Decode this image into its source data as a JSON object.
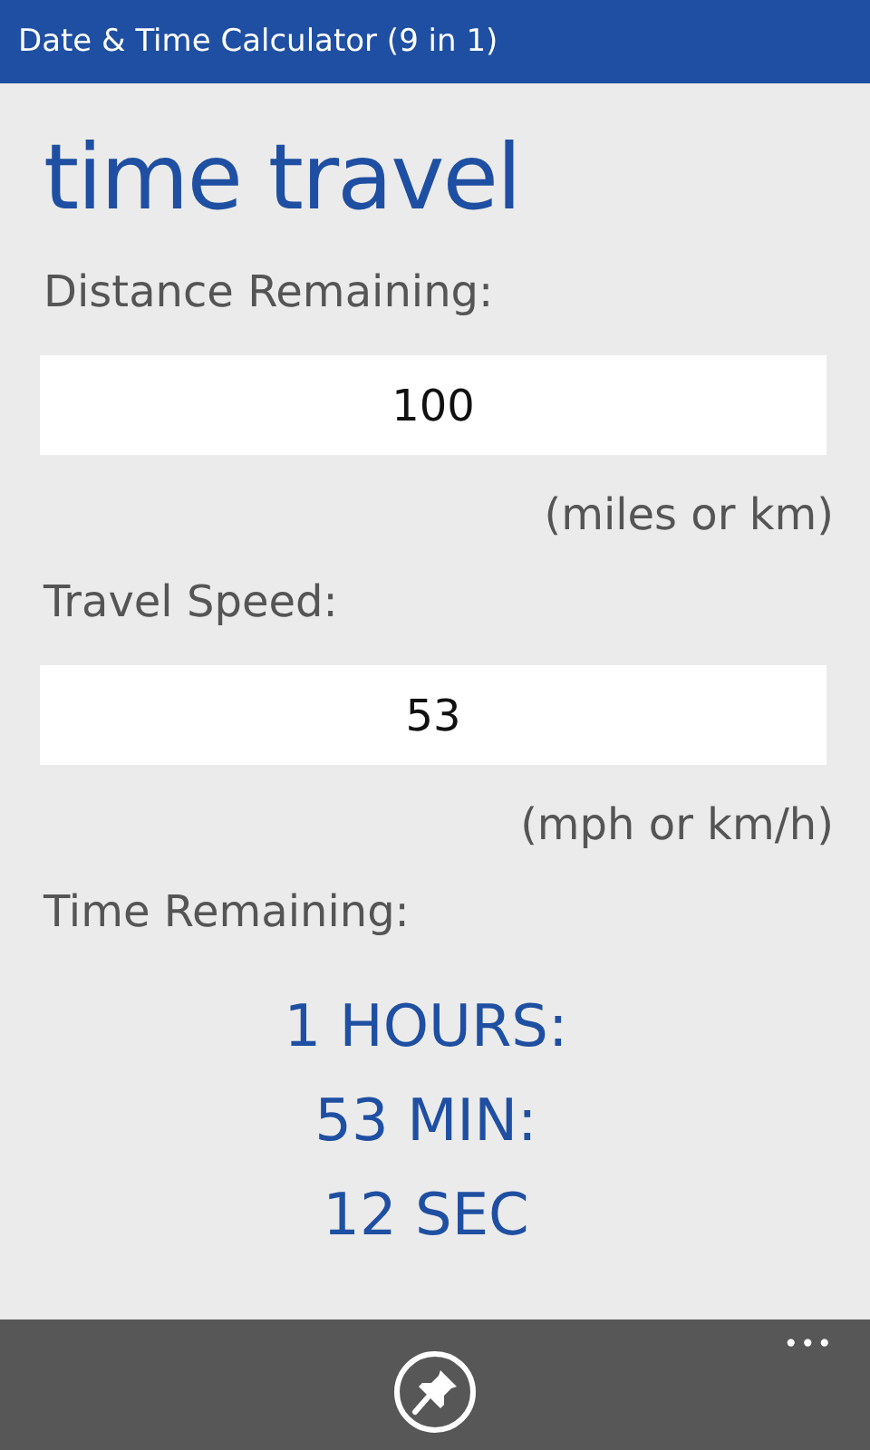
{
  "window": {
    "title": "Date & Time Calculator (9 in 1)"
  },
  "page_title": "time travel",
  "fields": [
    {
      "label": "Distance Remaining:",
      "value": "100",
      "unit": "(miles or km)"
    },
    {
      "label": "Travel Speed:",
      "value": "53",
      "unit": "(mph or km/h)"
    }
  ],
  "result": {
    "label": "Time Remaining:",
    "lines": [
      "1 HOURS:",
      "53 MIN:",
      "12 SEC"
    ]
  },
  "app_bar": {
    "more": "•••"
  }
}
